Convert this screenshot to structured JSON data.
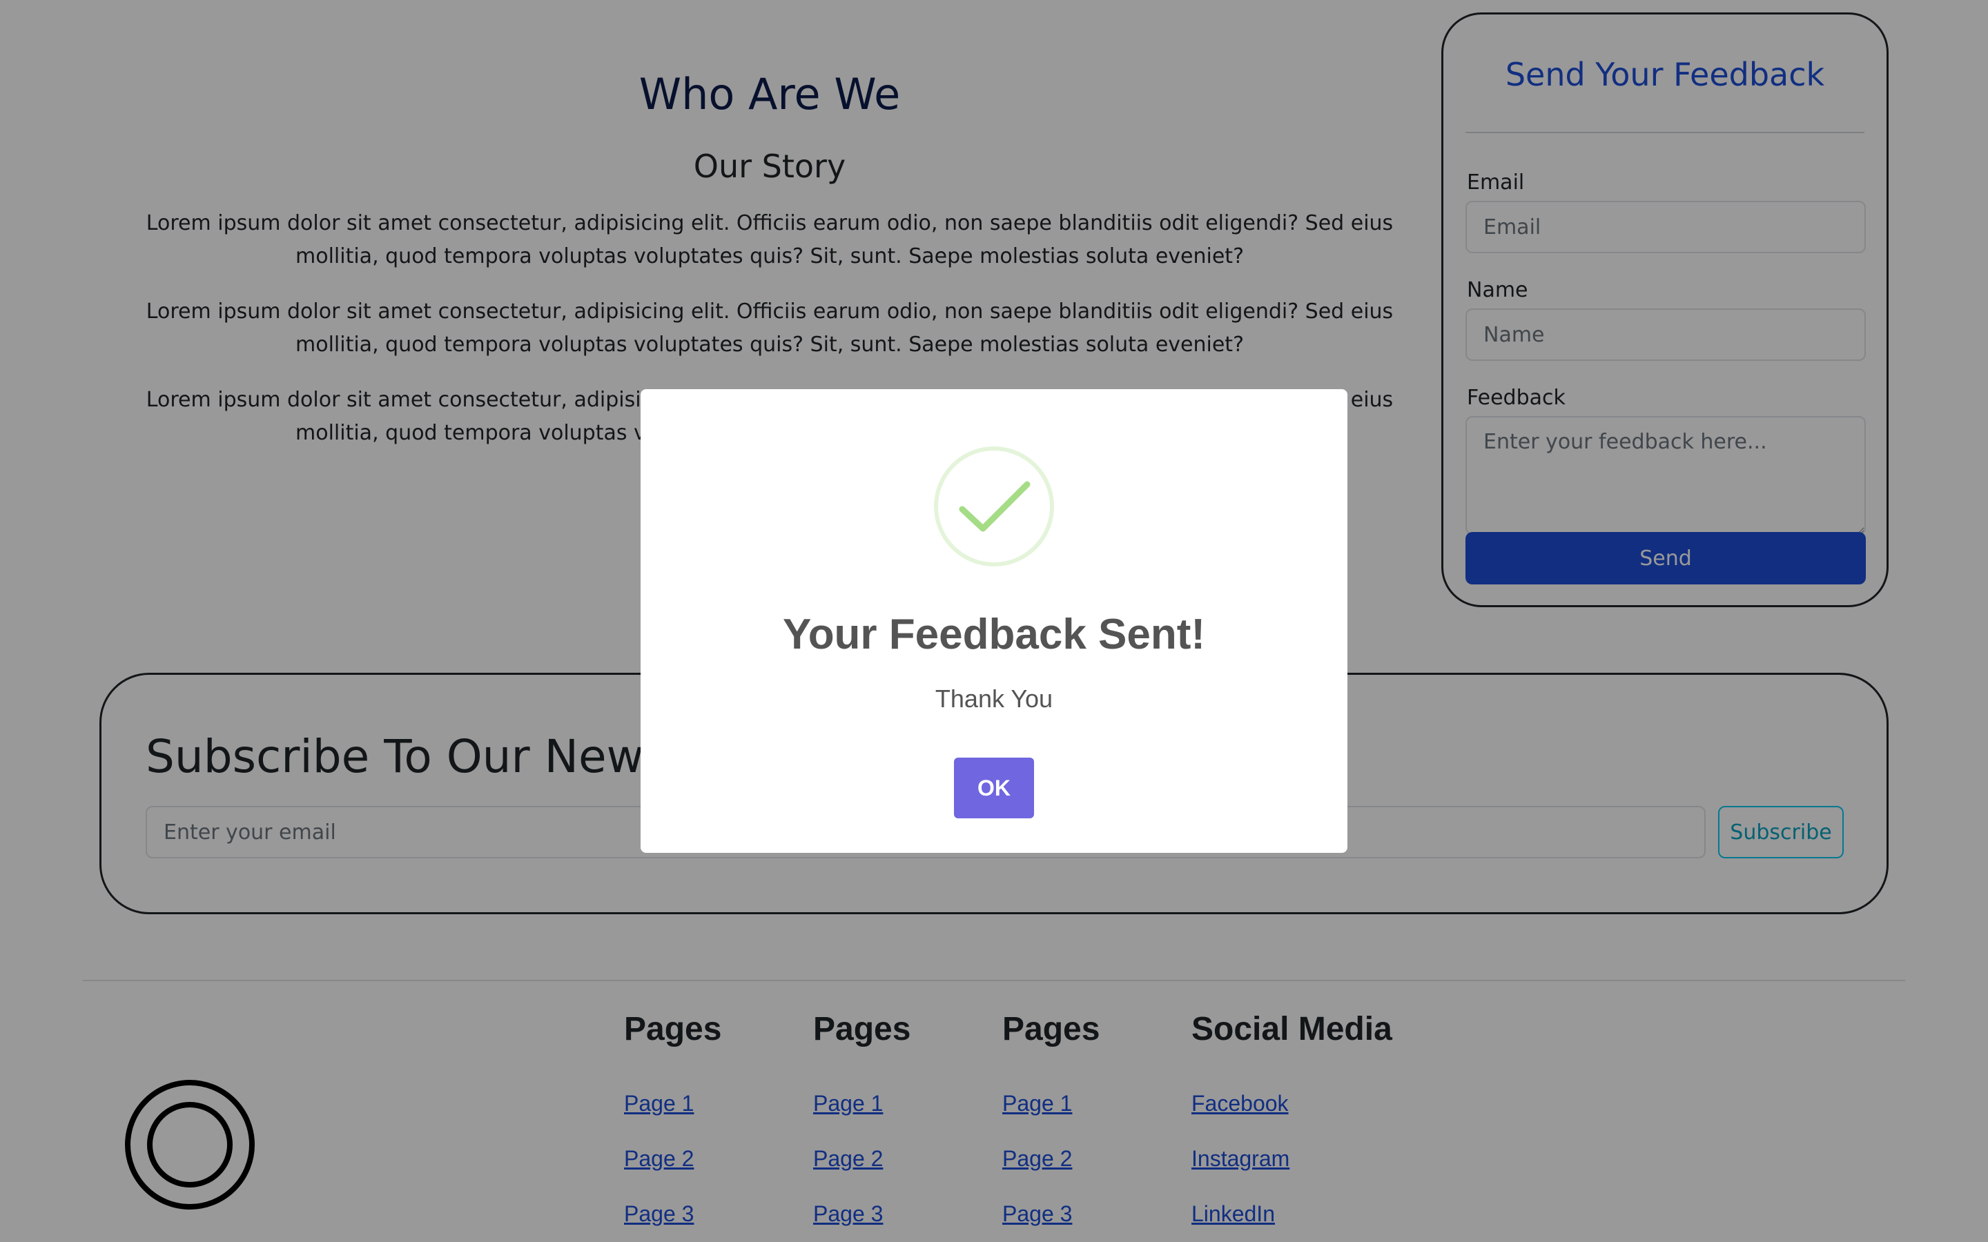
{
  "about": {
    "title": "Who Are We",
    "subtitle": "Our Story",
    "paragraphs": [
      "Lorem ipsum dolor sit amet consectetur, adipisicing elit. Officiis earum odio, non saepe blanditiis odit eligendi? Sed eius mollitia, quod tempora voluptas voluptates quis? Sit, sunt. Saepe molestias soluta eveniet?",
      "Lorem ipsum dolor sit amet consectetur, adipisicing elit. Officiis earum odio, non saepe blanditiis odit eligendi? Sed eius mollitia, quod tempora voluptas voluptates quis? Sit, sunt. Saepe molestias soluta eveniet?",
      "Lorem ipsum dolor sit amet consectetur, adipisicing elit. Officiis earum odio, non saepe blanditiis odit eligendi? Sed eius mollitia, quod tempora voluptas voluptates quis? Sit, sunt. Saepe molestias soluta eveniet?"
    ]
  },
  "feedback": {
    "title": "Send Your Feedback",
    "email_label": "Email",
    "email_placeholder": "Email",
    "name_label": "Name",
    "name_placeholder": "Name",
    "feedback_label": "Feedback",
    "feedback_placeholder": "Enter your feedback here...",
    "send_label": "Send"
  },
  "newsletter": {
    "title": "Subscribe To Our Newsletter",
    "email_placeholder": "Enter your email",
    "subscribe_label": "Subscribe"
  },
  "footer": {
    "columns": [
      {
        "heading": "Pages",
        "links": [
          "Page 1",
          "Page 2",
          "Page 3"
        ]
      },
      {
        "heading": "Pages",
        "links": [
          "Page 1",
          "Page 2",
          "Page 3"
        ]
      },
      {
        "heading": "Pages",
        "links": [
          "Page 1",
          "Page 2",
          "Page 3"
        ]
      },
      {
        "heading": "Social Media",
        "links": [
          "Facebook",
          "Instagram",
          "LinkedIn"
        ]
      }
    ],
    "logo_icon": "double-circle-logo"
  },
  "modal": {
    "icon": "success-check-icon",
    "title": "Your Feedback Sent!",
    "text": "Thank You",
    "ok_label": "OK"
  },
  "colors": {
    "primary": "#1d4ed8",
    "heading_dark": "#0d1b4c",
    "info": "#0dcaf0",
    "modal_button": "#7066e0",
    "success": "#a5dc86",
    "overlay": "rgba(0,0,0,0.4)"
  }
}
